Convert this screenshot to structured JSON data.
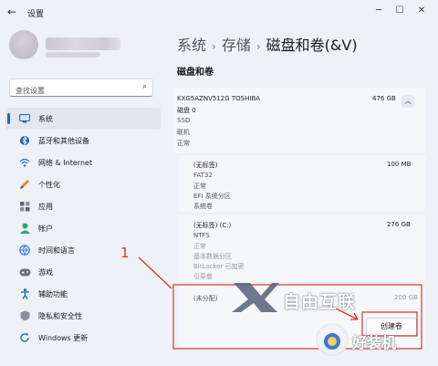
{
  "window": {
    "title": "设置",
    "controls": {
      "minimize": "─",
      "maximize": "☐",
      "close": "✕"
    }
  },
  "search": {
    "placeholder": "查找设置"
  },
  "nav": {
    "items": [
      {
        "label": "系统",
        "icon": "monitor-icon",
        "color": "#1767c2",
        "active": true
      },
      {
        "label": "蓝牙和其他设备",
        "icon": "bluetooth-icon",
        "color": "#1767c2"
      },
      {
        "label": "网络 & Internet",
        "icon": "network-icon",
        "color": "#1f6fd1"
      },
      {
        "label": "个性化",
        "icon": "brush-icon",
        "color": "#c26b1c"
      },
      {
        "label": "应用",
        "icon": "apps-icon",
        "color": "#4a5563"
      },
      {
        "label": "帐户",
        "icon": "account-icon",
        "color": "#2ea36a"
      },
      {
        "label": "时间和语言",
        "icon": "globe-icon",
        "color": "#1f6fd1"
      },
      {
        "label": "游戏",
        "icon": "game-icon",
        "color": "#4a5563"
      },
      {
        "label": "辅助功能",
        "icon": "accessibility-icon",
        "color": "#1767c2"
      },
      {
        "label": "隐私和安全性",
        "icon": "shield-icon",
        "color": "#6b7380"
      },
      {
        "label": "Windows 更新",
        "icon": "update-icon",
        "color": "#1f6fd1"
      }
    ]
  },
  "breadcrumb": {
    "crumb1": "系统",
    "crumb2": "存储",
    "current": "磁盘和卷(&V)",
    "sep": "›"
  },
  "section_title": "磁盘和卷",
  "disk": {
    "name": "KXG5AZNV512G TOSHIBA",
    "size": "476 GB",
    "label": "磁盘 0",
    "type": "SSD",
    "status1": "联机",
    "status2": "正常",
    "chevron": "︿"
  },
  "partitions": [
    {
      "name": "(无标签)",
      "size": "100 MB",
      "lines": [
        "FAT32",
        "正常",
        "EFI 系统分区",
        "系统卷"
      ]
    },
    {
      "name": "(无标签) (C:)",
      "size": "276 GB",
      "lines": [
        "NTFS",
        "正常",
        "基本数据分区",
        "BitLocker 已加密",
        "引导卷"
      ]
    },
    {
      "name": "(未分配)",
      "size": "200 GB"
    }
  ],
  "create_button": "创建卷",
  "annotation": "1",
  "watermark": {
    "text1": "自由互联",
    "text2": "好装机"
  }
}
